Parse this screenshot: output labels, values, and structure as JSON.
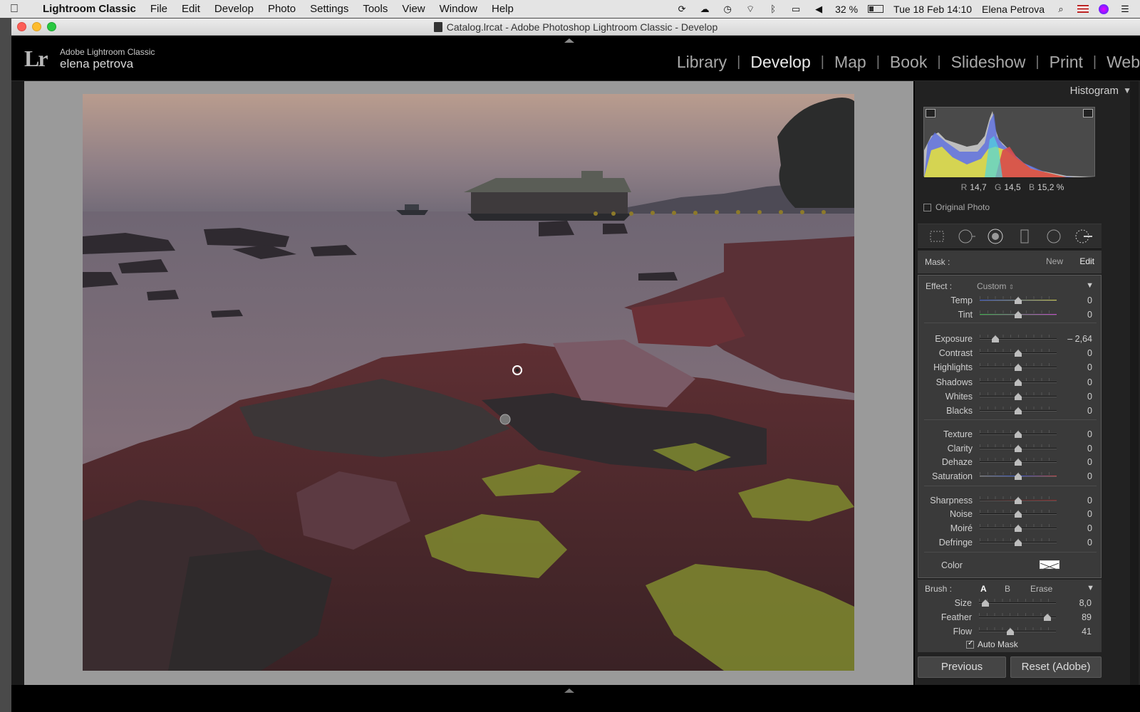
{
  "menubar": {
    "app_name": "Lightroom Classic",
    "items": [
      "File",
      "Edit",
      "Develop",
      "Photo",
      "Settings",
      "Tools",
      "View",
      "Window",
      "Help"
    ],
    "battery": "32 %",
    "datetime": "Tue 18 Feb 14:10",
    "user": "Elena Petrova"
  },
  "window": {
    "title": "Catalog.lrcat - Adobe Photoshop Lightroom Classic - Develop"
  },
  "identity": {
    "logo": "Lr",
    "brand_line1": "Adobe Lightroom Classic",
    "brand_line2": "elena petrova"
  },
  "modules": [
    "Library",
    "Develop",
    "Map",
    "Book",
    "Slideshow",
    "Print",
    "Web"
  ],
  "active_module": "Develop",
  "histogram": {
    "title": "Histogram",
    "r_label": "R",
    "r_value": "14,7",
    "g_label": "G",
    "g_value": "14,5",
    "b_label": "B",
    "b_value": "15,2 %",
    "original_photo": "Original Photo"
  },
  "mask": {
    "label": "Mask :",
    "new": "New",
    "edit": "Edit"
  },
  "effect": {
    "label": "Effect :",
    "preset": "Custom",
    "color_label": "Color",
    "sliders": [
      {
        "label": "Temp",
        "value": "0",
        "pos": 0.5
      },
      {
        "label": "Tint",
        "value": "0",
        "pos": 0.5
      },
      {
        "label": "Exposure",
        "value": "– 2,64",
        "pos": 0.2
      },
      {
        "label": "Contrast",
        "value": "0",
        "pos": 0.5
      },
      {
        "label": "Highlights",
        "value": "0",
        "pos": 0.5
      },
      {
        "label": "Shadows",
        "value": "0",
        "pos": 0.5
      },
      {
        "label": "Whites",
        "value": "0",
        "pos": 0.5
      },
      {
        "label": "Blacks",
        "value": "0",
        "pos": 0.5
      },
      {
        "label": "Texture",
        "value": "0",
        "pos": 0.5
      },
      {
        "label": "Clarity",
        "value": "0",
        "pos": 0.5
      },
      {
        "label": "Dehaze",
        "value": "0",
        "pos": 0.5
      },
      {
        "label": "Saturation",
        "value": "0",
        "pos": 0.5
      },
      {
        "label": "Sharpness",
        "value": "0",
        "pos": 0.5
      },
      {
        "label": "Noise",
        "value": "0",
        "pos": 0.5
      },
      {
        "label": "Moiré",
        "value": "0",
        "pos": 0.5
      },
      {
        "label": "Defringe",
        "value": "0",
        "pos": 0.5
      }
    ]
  },
  "brush": {
    "label": "Brush :",
    "tab_a": "A",
    "tab_b": "B",
    "tab_erase": "Erase",
    "sliders": [
      {
        "label": "Size",
        "value": "8,0",
        "pos": 0.08
      },
      {
        "label": "Feather",
        "value": "89",
        "pos": 0.89
      },
      {
        "label": "Flow",
        "value": "41",
        "pos": 0.41
      }
    ],
    "auto_mask": "Auto Mask"
  },
  "buttons": {
    "previous": "Previous",
    "reset": "Reset (Adobe)"
  }
}
